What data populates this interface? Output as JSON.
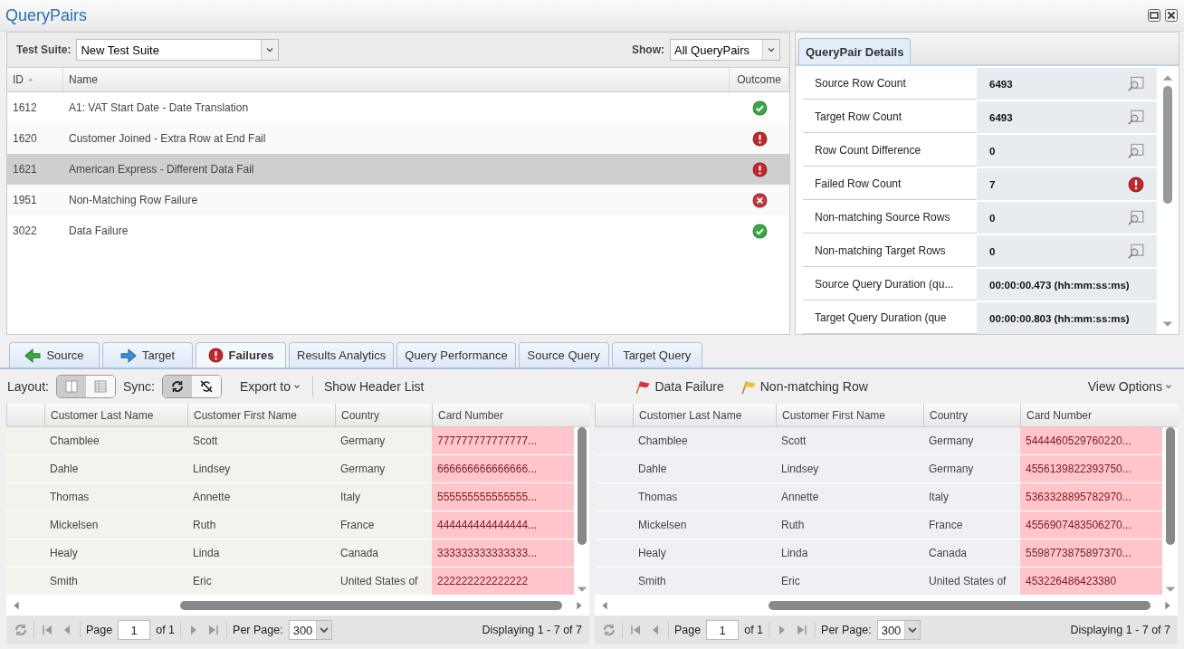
{
  "window": {
    "title": "QueryPairs"
  },
  "list_panel": {
    "filters": [
      {
        "label": "Test Suite:",
        "value": "New Test Suite"
      },
      {
        "label": "Show:",
        "value": "All QueryPairs"
      }
    ],
    "columns": [
      {
        "label": "ID",
        "sorted": true
      },
      {
        "label": "Name",
        "sorted": false
      },
      {
        "label": "Outcome",
        "sorted": false
      }
    ],
    "rows": [
      {
        "id": "1612",
        "name": "A1: VAT Start Date - Date Translation",
        "kind": "pass",
        "selected": false
      },
      {
        "id": "1620",
        "name": "Customer Joined - Extra Row at End Fail",
        "kind": "fail",
        "selected": false
      },
      {
        "id": "1621",
        "name": "American Express - Different Data Fail",
        "kind": "fail",
        "selected": true
      },
      {
        "id": "1951",
        "name": "Non-Matching Row Failure",
        "kind": "error",
        "selected": false
      },
      {
        "id": "3022",
        "name": "Data Failure",
        "kind": "pass",
        "selected": false
      }
    ]
  },
  "details": {
    "tab": "QueryPair Details",
    "rows": [
      {
        "label": "Source Row Count",
        "value": "6493",
        "kind": "view"
      },
      {
        "label": "Target Row Count",
        "value": "6493",
        "kind": "view"
      },
      {
        "label": "Row Count Difference",
        "value": "0",
        "kind": "view"
      },
      {
        "label": "Failed Row Count",
        "value": "7",
        "kind": "fail"
      },
      {
        "label": "Non-matching Source Rows",
        "value": "0",
        "kind": "view"
      },
      {
        "label": "Non-matching Target Rows",
        "value": "0",
        "kind": "view"
      },
      {
        "label": "Source Query Duration (qu...",
        "value": "00:00:00.473 (hh:mm:ss:ms)",
        "kind": "plain"
      },
      {
        "label": "Target Query Duration (que",
        "value": "00:00:00.803 (hh:mm:ss:ms)",
        "kind": "plain"
      }
    ]
  },
  "tabs": [
    {
      "label": "Source",
      "kind": "source",
      "selected": false
    },
    {
      "label": "Target",
      "kind": "target",
      "selected": false
    },
    {
      "label": "Failures",
      "kind": "failures",
      "selected": true
    },
    {
      "label": "Results Analytics",
      "kind": "plain",
      "selected": false
    },
    {
      "label": "Query Performance",
      "kind": "plain",
      "selected": false
    },
    {
      "label": "Source Query",
      "kind": "plain",
      "selected": false
    },
    {
      "label": "Target Query",
      "kind": "plain",
      "selected": false
    }
  ],
  "toolbar": {
    "layout_label": "Layout:",
    "layout_modes": [
      {
        "kind": "columns",
        "selected": true
      },
      {
        "kind": "grid",
        "selected": false
      }
    ],
    "sync_label": "Sync:",
    "sync_modes": [
      {
        "kind": "sync",
        "selected": true
      },
      {
        "kind": "nosync",
        "selected": false
      }
    ],
    "export": "Export to",
    "show_header": "Show Header List",
    "legend": [
      {
        "label": "Data Failure",
        "kind": "data"
      },
      {
        "label": "Non-matching Row",
        "kind": "nonmatch"
      }
    ],
    "view_options": "View Options"
  },
  "grids": [
    {
      "kind": "source",
      "columns": [
        {
          "label": "Customer Last Name",
          "failed": false
        },
        {
          "label": "Customer First Name",
          "failed": false
        },
        {
          "label": "Country",
          "failed": false
        },
        {
          "label": "Card Number",
          "failed": true
        }
      ],
      "rows": [
        [
          "Chamblee",
          "Scott",
          "Germany",
          "777777777777777..."
        ],
        [
          "Dahle",
          "Lindsey",
          "Germany",
          "666666666666666..."
        ],
        [
          "Thomas",
          "Annette",
          "Italy",
          "555555555555555..."
        ],
        [
          "Mickelsen",
          "Ruth",
          "France",
          "444444444444444..."
        ],
        [
          "Healy",
          "Linda",
          "Canada",
          "333333333333333..."
        ],
        [
          "Smith",
          "Eric",
          "United States of",
          "222222222222222"
        ]
      ],
      "pager": {
        "page_label": "Page",
        "page": "1",
        "of": "of 1",
        "per_page_label": "Per Page:",
        "per_page": "300",
        "display": "Displaying 1 - 7 of 7"
      }
    },
    {
      "kind": "target",
      "columns": [
        {
          "label": "Customer Last Name",
          "failed": false
        },
        {
          "label": "Customer First Name",
          "failed": false
        },
        {
          "label": "Country",
          "failed": false
        },
        {
          "label": "Card Number",
          "failed": true
        }
      ],
      "rows": [
        [
          "Chamblee",
          "Scott",
          "Germany",
          "5444460529760220..."
        ],
        [
          "Dahle",
          "Lindsey",
          "Germany",
          "4556139822393750..."
        ],
        [
          "Thomas",
          "Annette",
          "Italy",
          "5363328895782970..."
        ],
        [
          "Mickelsen",
          "Ruth",
          "France",
          "4556907483506270..."
        ],
        [
          "Healy",
          "Linda",
          "Canada",
          "5598773875897370..."
        ],
        [
          "Smith",
          "Eric",
          "United States of",
          "453226486423380"
        ]
      ],
      "pager": {
        "page_label": "Page",
        "page": "1",
        "of": "of 1",
        "per_page_label": "Per Page:",
        "per_page": "300",
        "display": "Displaying 1 - 7 of 7"
      }
    }
  ]
}
